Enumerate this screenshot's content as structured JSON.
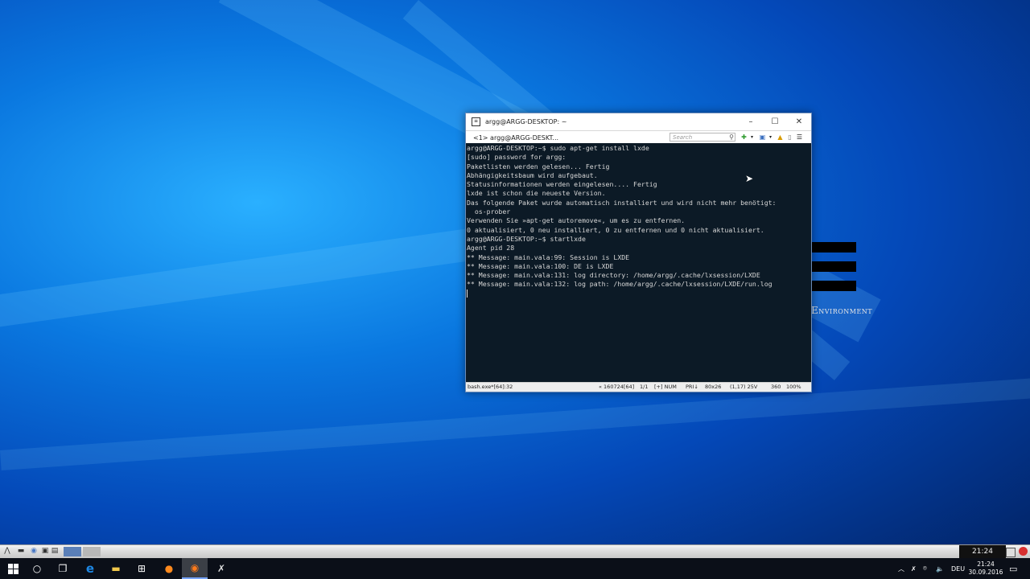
{
  "terminal": {
    "title": "argg@ARGG-DESKTOP: ~",
    "tab_label": "<1> argg@ARGG-DESKT...",
    "search_placeholder": "Search",
    "lines": [
      "argg@ARGG-DESKTOP:~$ sudo apt-get install lxde",
      "[sudo] password for argg:",
      "Paketlisten werden gelesen... Fertig",
      "Abhängigkeitsbaum wird aufgebaut.",
      "Statusinformationen werden eingelesen.... Fertig",
      "lxde ist schon die neueste Version.",
      "Das folgende Paket wurde automatisch installiert und wird nicht mehr benötigt:",
      "  os-prober",
      "Verwenden Sie »apt-get autoremove«, um es zu entfernen.",
      "0 aktualisiert, 0 neu installiert, 0 zu entfernen und 0 nicht aktualisiert.",
      "argg@ARGG-DESKTOP:~$ startlxde",
      "Agent pid 28",
      "** Message: main.vala:99: Session is LXDE",
      "** Message: main.vala:100: DE is LXDE",
      "** Message: main.vala:131: log directory: /home/argg/.cache/lxsession/LXDE",
      "** Message: main.vala:132: log path: /home/argg/.cache/lxsession/LXDE/run.log"
    ],
    "status": {
      "process": "bash.exe*[64]:32",
      "pid": "« 160724[64]",
      "page": "1/1",
      "mode": "[+] NUM",
      "priority": "PRI↓",
      "size": "80x26",
      "position": "(1,17) 25V",
      "buffer": "360",
      "zoom": "100%"
    }
  },
  "wallpaper": {
    "logo_text": "Environment"
  },
  "lxpanel": {
    "clock": "21:24"
  },
  "taskbar": {
    "language": "DEU",
    "time": "21:24",
    "date": "30.09.2016"
  },
  "icons": {
    "start": "windows-logo-icon",
    "cortana": "cortana-circle-icon",
    "taskview": "task-view-icon",
    "edge": "edge-browser-icon",
    "explorer": "file-explorer-icon",
    "store": "store-icon",
    "firefox": "firefox-icon",
    "ubuntu": "ubuntu-icon",
    "xming": "xming-icon"
  }
}
